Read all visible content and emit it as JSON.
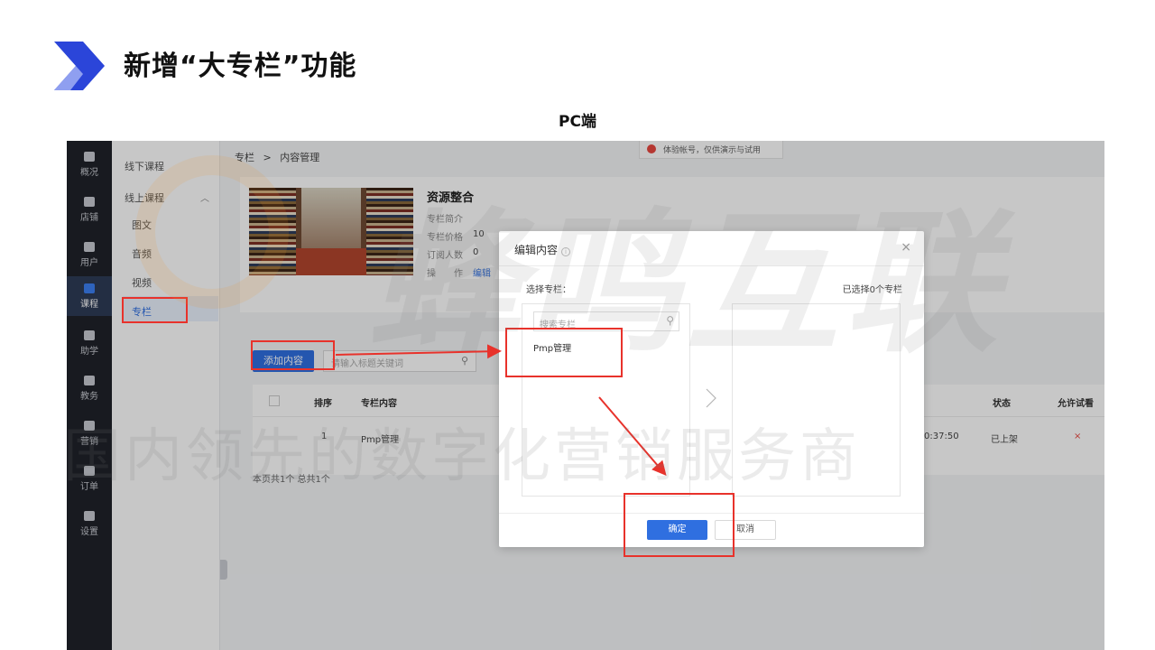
{
  "slide": {
    "title": "新增“大专栏”功能",
    "subtitle": "PC端"
  },
  "nav": {
    "items": [
      {
        "label": "概况",
        "icon": "chart-icon"
      },
      {
        "label": "店铺",
        "icon": "store-icon"
      },
      {
        "label": "用户",
        "icon": "user-icon"
      },
      {
        "label": "课程",
        "icon": "course-icon"
      },
      {
        "label": "助学",
        "icon": "gamepad-icon"
      },
      {
        "label": "教务",
        "icon": "book-icon"
      },
      {
        "label": "营销",
        "icon": "tag-icon"
      },
      {
        "label": "订单",
        "icon": "order-icon"
      },
      {
        "label": "设置",
        "icon": "gear-icon"
      }
    ]
  },
  "subnav": {
    "offline": "线下课程",
    "online": "线上课程",
    "children": [
      "图文",
      "音频",
      "视频",
      "专栏"
    ]
  },
  "breadcrumb": {
    "root": "专栏",
    "sep": ">",
    "current": "内容管理"
  },
  "notice": "体验帐号，仅供演示与试用",
  "column": {
    "title": "资源整合",
    "labels": [
      "专栏简介",
      "专栏价格",
      "订阅人数",
      "操　　作"
    ],
    "price": "10",
    "subscribers": "0",
    "edit_link": "编辑"
  },
  "toolbar": {
    "add_button": "添加内容",
    "search_placeholder": "请输入标题关键词"
  },
  "table": {
    "headers": [
      "排序",
      "专栏内容",
      "状态",
      "允许试看"
    ],
    "rows": [
      {
        "order": "1",
        "content": "Pmp管理",
        "time": "0:37:50",
        "status": "已上架",
        "trial": "×"
      }
    ],
    "footer": "本页共1个 总共1个"
  },
  "modal": {
    "title": "编辑内容",
    "help": "i",
    "close": "×",
    "select_label": "选择专栏：",
    "selected_count": "已选择0个专栏",
    "search_placeholder": "搜索专栏",
    "items": [
      "Pmp管理"
    ],
    "ok": "确定",
    "cancel": "取消"
  },
  "watermark": {
    "big": "蜂鸣互联",
    "line": "国内领先的数字化营销服务商"
  },
  "colors": {
    "accent": "#2f6fe0",
    "annotation": "#e8322b",
    "nav_bg": "#1f2229"
  }
}
